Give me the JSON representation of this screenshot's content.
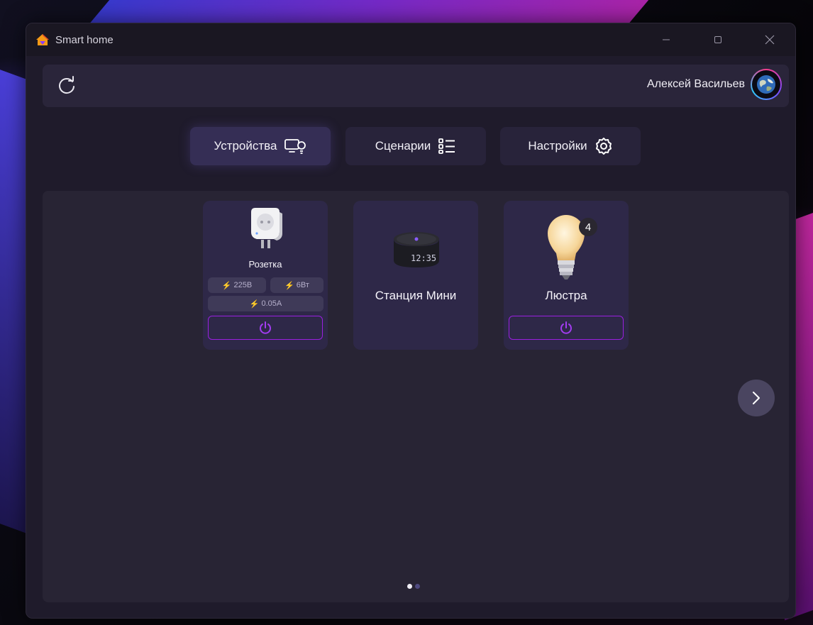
{
  "window": {
    "title": "Smart home"
  },
  "header": {
    "user_name": "Алексей Васильев"
  },
  "tabs": [
    {
      "label": "Устройства",
      "icon": "devices-icon",
      "active": true
    },
    {
      "label": "Сценарии",
      "icon": "list-icon",
      "active": false
    },
    {
      "label": "Настройки",
      "icon": "gear-icon",
      "active": false
    }
  ],
  "devices": [
    {
      "name": "Розетка",
      "icon": "smart-plug-icon",
      "metrics": {
        "voltage": "225В",
        "power": "6Вт",
        "current": "0.05А"
      },
      "has_power_button": true
    },
    {
      "name": "Станция Мини",
      "icon": "smart-speaker-icon",
      "clock": "12:35",
      "has_power_button": false
    },
    {
      "name": "Люстра",
      "icon": "light-bulb-icon",
      "badge": "4",
      "has_power_button": true
    }
  ],
  "pagination": {
    "pages": 2,
    "current": 1
  },
  "colors": {
    "accent": "#9a1fe0",
    "window_bg": "#1f1b2b",
    "card_bg": "#2e2848"
  }
}
